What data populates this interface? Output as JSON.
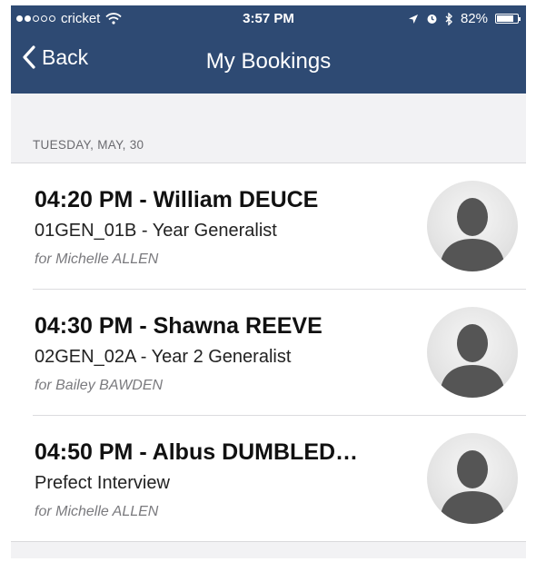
{
  "status_bar": {
    "carrier": "cricket",
    "time": "3:57 PM",
    "battery": "82%",
    "battery_level": 0.82,
    "signal_full": 2,
    "signal_total": 5
  },
  "nav": {
    "back_label": "Back",
    "title": "My Bookings"
  },
  "section": {
    "header": "TUESDAY, MAY, 30"
  },
  "bookings": [
    {
      "title": "04:20 PM - William DEUCE",
      "subtitle": "01GEN_01B - Year  Generalist",
      "for": "for Michelle ALLEN"
    },
    {
      "title": "04:30 PM - Shawna REEVE",
      "subtitle": "02GEN_02A - Year 2 Generalist",
      "for": "for Bailey BAWDEN"
    },
    {
      "title": "04:50 PM - Albus DUMBLED…",
      "subtitle": "Prefect Interview",
      "for": "for Michelle ALLEN"
    }
  ],
  "colors": {
    "nav_background": "#2e4a73",
    "page_background": "#f2f2f4"
  },
  "icons": {
    "back": "chevron-left-icon",
    "avatar": "person-placeholder-icon",
    "wifi": "wifi-icon",
    "location": "location-arrow-icon",
    "alarm": "alarm-icon",
    "bluetooth": "bluetooth-icon",
    "battery": "battery-icon"
  }
}
